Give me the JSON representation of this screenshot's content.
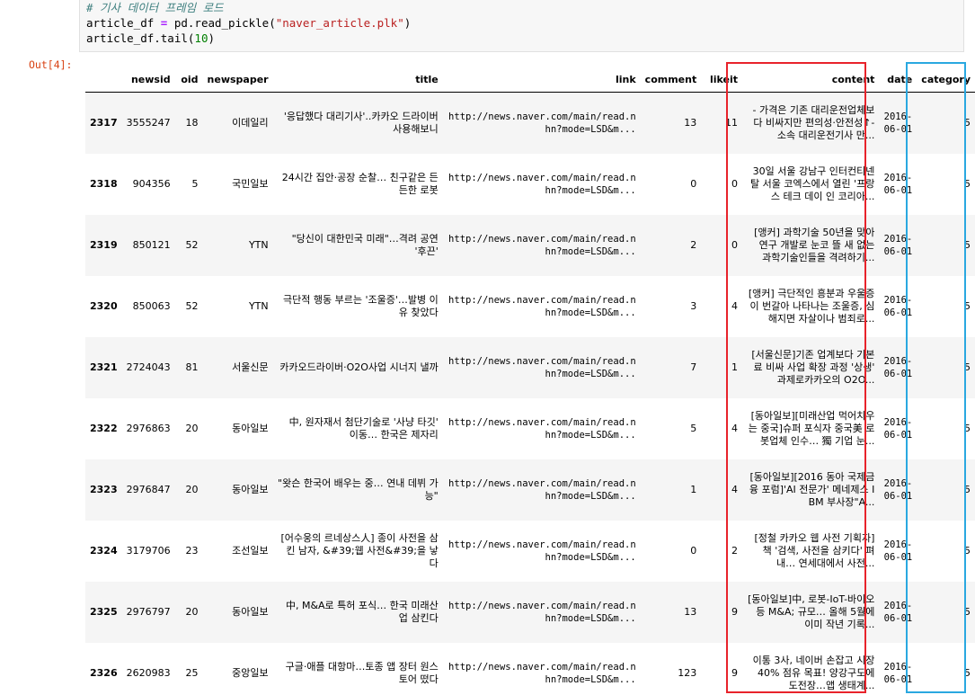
{
  "code": {
    "comment": "# 기사 데이터 프레임 로드",
    "line2_var": "article_df",
    "line2_op": " = ",
    "line2_func": "pd.read_pickle(",
    "line2_str": "\"naver_article.plk\"",
    "line2_close": ")",
    "line3_call": "article_df.tail(",
    "line3_num": "10",
    "line3_close": ")"
  },
  "output_prompt": "Out[4]:",
  "table": {
    "columns": [
      "",
      "newsid",
      "oid",
      "newspaper",
      "title",
      "link",
      "comment",
      "likeit",
      "content",
      "date",
      "category"
    ],
    "rows": [
      {
        "idx": "2317",
        "newsid": "3555247",
        "oid": "18",
        "newspaper": "이데일리",
        "title": "'응답했다 대리기사'..카카오 드라이버 사용해보니",
        "link": "http://news.naver.com/main/read.nhn?mode=LSD&m...",
        "comment": "13",
        "likeit": "11",
        "content": "- 가격은 기존 대리운전업체보다 비싸지만 편의성·안전성↑- 소속 대리운전기사 만...",
        "date": "2016-06-01",
        "category": "5"
      },
      {
        "idx": "2318",
        "newsid": "904356",
        "oid": "5",
        "newspaper": "국민일보",
        "title": "24시간 집안·공장 순찰… 친구같은 든든한 로봇",
        "link": "http://news.naver.com/main/read.nhn?mode=LSD&m...",
        "comment": "0",
        "likeit": "0",
        "content": "30일 서울 강남구 인터컨티넨탈 서울 코엑스에서 열린 '프랑스 테크 데이 인 코리아...",
        "date": "2016-06-01",
        "category": "5"
      },
      {
        "idx": "2319",
        "newsid": "850121",
        "oid": "52",
        "newspaper": "YTN",
        "title": "\"당신이 대한민국 미래\"…격려 공연 '후끈'",
        "link": "http://news.naver.com/main/read.nhn?mode=LSD&m...",
        "comment": "2",
        "likeit": "0",
        "content": "[앵커] 과학기술 50년을 맞아 연구 개발로 눈코 뜰 새 없는 과학기술인들을 격려하기...",
        "date": "2016-06-01",
        "category": "5"
      },
      {
        "idx": "2320",
        "newsid": "850063",
        "oid": "52",
        "newspaper": "YTN",
        "title": "극단적 행동 부르는 '조울증'…발병 이유 찾았다",
        "link": "http://news.naver.com/main/read.nhn?mode=LSD&m...",
        "comment": "3",
        "likeit": "4",
        "content": "[앵커] 극단적인 흥분과 우울증이 번갈아 나타나는 조울증, 심해지면 자살이나 범죄로...",
        "date": "2016-06-01",
        "category": "5"
      },
      {
        "idx": "2321",
        "newsid": "2724043",
        "oid": "81",
        "newspaper": "서울신문",
        "title": "카카오드라이버·O2O사업 시너지 낼까",
        "link": "http://news.naver.com/main/read.nhn?mode=LSD&m...",
        "comment": "7",
        "likeit": "1",
        "content": "[서울신문]기존 업계보다 기본료 비싸 사업 확장 과정 '상생' 과제로카카오의 O2O...",
        "date": "2016-06-01",
        "category": "5"
      },
      {
        "idx": "2322",
        "newsid": "2976863",
        "oid": "20",
        "newspaper": "동아일보",
        "title": "中, 원자재서 첨단기술로 '사냥 타깃' 이동… 한국은 제자리",
        "link": "http://news.naver.com/main/read.nhn?mode=LSD&m...",
        "comment": "5",
        "likeit": "4",
        "content": "[동아일보][미래산업 먹어치우는 중국]슈퍼 포식자 중국美 로봇업체 인수… 獨 기업 눈...",
        "date": "2016-06-01",
        "category": "5"
      },
      {
        "idx": "2323",
        "newsid": "2976847",
        "oid": "20",
        "newspaper": "동아일보",
        "title": "\"왓슨 한국어 배우는 중… 연내 데뷔 가능\"",
        "link": "http://news.naver.com/main/read.nhn?mode=LSD&m...",
        "comment": "1",
        "likeit": "4",
        "content": "[동아일보][2016 동아 국제금융 포럼]'AI 전문가' 메네제스 IBM 부사장\"A...",
        "date": "2016-06-01",
        "category": "5"
      },
      {
        "idx": "2324",
        "newsid": "3179706",
        "oid": "23",
        "newspaper": "조선일보",
        "title": "[어수웅의 르네상스人] 종이 사전을 삼킨 남자, &#39;웹 사전&#39;을 낳다",
        "link": "http://news.naver.com/main/read.nhn?mode=LSD&m...",
        "comment": "0",
        "likeit": "2",
        "content": "[정철 카카오 웹 사전 기획자] 책 '검색, 사전을 삼키다' 펴내… 연세대에서 사전...",
        "date": "2016-06-01",
        "category": "5"
      },
      {
        "idx": "2325",
        "newsid": "2976797",
        "oid": "20",
        "newspaper": "동아일보",
        "title": "中, M&A로 특허 포식… 한국 미래산업 삼킨다",
        "link": "http://news.naver.com/main/read.nhn?mode=LSD&m...",
        "comment": "13",
        "likeit": "9",
        "content": "[동아일보]中, 로봇-IoT-바이오 등 M&A; 규모… 올해 5월에 이미 작년 기록...",
        "date": "2016-06-01",
        "category": "5"
      },
      {
        "idx": "2326",
        "newsid": "2620983",
        "oid": "25",
        "newspaper": "중앙일보",
        "title": "구글·애플 대항마…토종 앱 장터 원스토어 떴다",
        "link": "http://news.naver.com/main/read.nhn?mode=LSD&m...",
        "comment": "123",
        "likeit": "9",
        "content": "이통 3사, 네이버 손잡고 시장 40% 점유 목표! 양강구도에 도전장…앱 생태계...",
        "date": "2016-06-01",
        "category": "5"
      }
    ]
  },
  "highlights": {
    "content_color": "#e8232b",
    "category_color": "#2aa8e0"
  }
}
